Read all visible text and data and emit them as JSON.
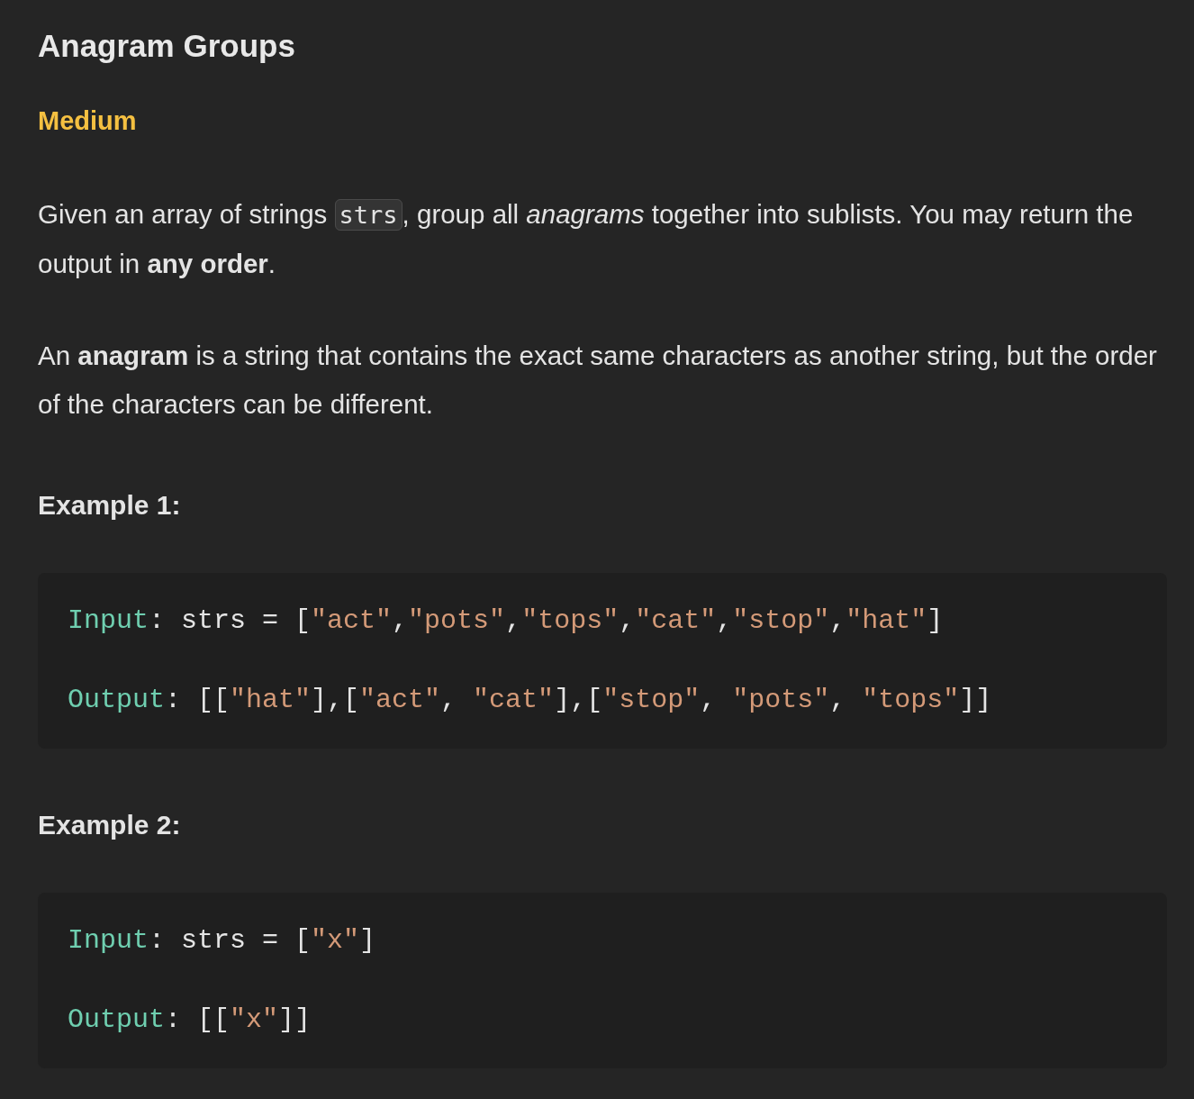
{
  "title": "Anagram Groups",
  "difficulty": "Medium",
  "paragraphs": [
    {
      "parts": [
        {
          "kind": "text",
          "text": "Given an array of strings "
        },
        {
          "kind": "code",
          "text": "strs"
        },
        {
          "kind": "text",
          "text": ", group all *anagrams* together into sublists. You may return the output in **any order**."
        }
      ]
    },
    {
      "parts": [
        {
          "kind": "text",
          "text": "An **anagram** is a string that contains the exact same characters as another string, but the order of the characters can be different."
        }
      ]
    }
  ],
  "examples": [
    {
      "heading": "Example 1:",
      "lines": [
        [
          {
            "kind": "label",
            "text": "Input"
          },
          {
            "kind": "plain",
            "text": ": strs = ["
          },
          {
            "kind": "string",
            "text": "\"act\""
          },
          {
            "kind": "plain",
            "text": ","
          },
          {
            "kind": "string",
            "text": "\"pots\""
          },
          {
            "kind": "plain",
            "text": ","
          },
          {
            "kind": "string",
            "text": "\"tops\""
          },
          {
            "kind": "plain",
            "text": ","
          },
          {
            "kind": "string",
            "text": "\"cat\""
          },
          {
            "kind": "plain",
            "text": ","
          },
          {
            "kind": "string",
            "text": "\"stop\""
          },
          {
            "kind": "plain",
            "text": ","
          },
          {
            "kind": "string",
            "text": "\"hat\""
          },
          {
            "kind": "plain",
            "text": "]"
          }
        ],
        [
          {
            "kind": "label",
            "text": "Output"
          },
          {
            "kind": "plain",
            "text": ": [["
          },
          {
            "kind": "string",
            "text": "\"hat\""
          },
          {
            "kind": "plain",
            "text": "],["
          },
          {
            "kind": "string",
            "text": "\"act\""
          },
          {
            "kind": "plain",
            "text": ", "
          },
          {
            "kind": "string",
            "text": "\"cat\""
          },
          {
            "kind": "plain",
            "text": "],["
          },
          {
            "kind": "string",
            "text": "\"stop\""
          },
          {
            "kind": "plain",
            "text": ", "
          },
          {
            "kind": "string",
            "text": "\"pots\""
          },
          {
            "kind": "plain",
            "text": ", "
          },
          {
            "kind": "string",
            "text": "\"tops\""
          },
          {
            "kind": "plain",
            "text": "]]"
          }
        ]
      ]
    },
    {
      "heading": "Example 2:",
      "lines": [
        [
          {
            "kind": "label",
            "text": "Input"
          },
          {
            "kind": "plain",
            "text": ": strs = ["
          },
          {
            "kind": "string",
            "text": "\"x\""
          },
          {
            "kind": "plain",
            "text": "]"
          }
        ],
        [
          {
            "kind": "label",
            "text": "Output"
          },
          {
            "kind": "plain",
            "text": ": [["
          },
          {
            "kind": "string",
            "text": "\"x\""
          },
          {
            "kind": "plain",
            "text": "]]"
          }
        ]
      ]
    }
  ]
}
